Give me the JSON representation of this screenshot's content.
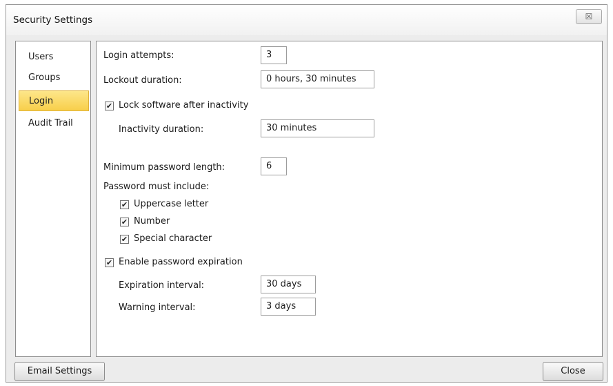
{
  "window": {
    "title": "Security Settings",
    "close_glyph": "☒"
  },
  "sidebar": {
    "items": [
      {
        "label": "Users"
      },
      {
        "label": "Groups"
      },
      {
        "label": "Login"
      },
      {
        "label": "Audit Trail"
      }
    ]
  },
  "login": {
    "attempts_label": "Login attempts:",
    "attempts_value": "3",
    "lockout_label": "Lockout duration:",
    "lockout_value": "0 hours, 30 minutes",
    "lock_inactivity_label": "Lock software after inactivity",
    "inactivity_label": "Inactivity duration:",
    "inactivity_value": "30 minutes",
    "min_length_label": "Minimum password length:",
    "min_length_value": "6",
    "must_include_label": "Password must include:",
    "uppercase_label": "Uppercase letter",
    "number_label": "Number",
    "special_label": "Special character",
    "expiration_enable_label": "Enable password expiration",
    "expiration_interval_label": "Expiration interval:",
    "expiration_interval_value": "30 days",
    "warning_interval_label": "Warning interval:",
    "warning_interval_value": "3 days",
    "check_glyph": "✔"
  },
  "footer": {
    "email_settings_label": "Email Settings",
    "close_label": "Close"
  }
}
